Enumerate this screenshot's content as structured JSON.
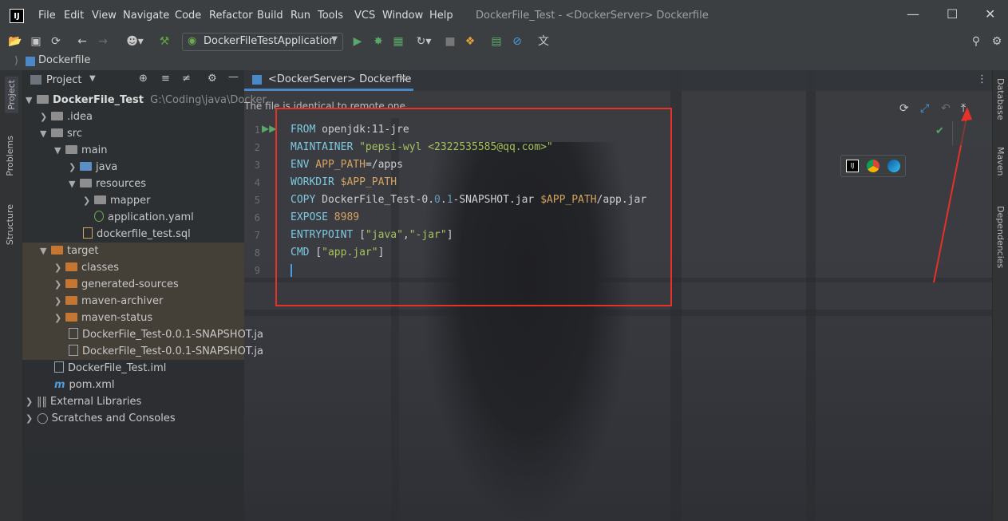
{
  "app": {
    "window_title": "DockerFile_Test - <DockerServer> Dockerfile",
    "logo_text": "IJ"
  },
  "menu": [
    "File",
    "Edit",
    "View",
    "Navigate",
    "Code",
    "Refactor",
    "Build",
    "Run",
    "Tools",
    "VCS",
    "Window",
    "Help"
  ],
  "toolbar": {
    "run_config": "DockerFileTestApplication"
  },
  "breadcrumb": {
    "item": "Dockerfile"
  },
  "left_stripe": {
    "tabs": [
      "Project",
      "Problems",
      "Structure"
    ]
  },
  "project": {
    "title": "Project",
    "root_name": "DockerFile_Test",
    "root_path": "G:\\Coding\\java\\Docker",
    "items": [
      ".idea",
      "src",
      "main",
      "java",
      "resources",
      "mapper",
      "application.yaml",
      "dockerfile_test.sql",
      "target",
      "classes",
      "generated-sources",
      "maven-archiver",
      "maven-status",
      "DockerFile_Test-0.0.1-SNAPSHOT.ja",
      "DockerFile_Test-0.0.1-SNAPSHOT.ja",
      "DockerFile_Test.iml",
      "pom.xml",
      "External Libraries",
      "Scratches and Consoles"
    ]
  },
  "editor": {
    "tab_label": "<DockerServer> Dockerfile",
    "notice": "The file is identical to remote one.",
    "line_numbers": [
      "1",
      "2",
      "3",
      "4",
      "5",
      "6",
      "7",
      "8",
      "9"
    ],
    "code": {
      "l1": {
        "kw": "FROM",
        "rest": " openjdk:11-jre"
      },
      "l2": {
        "kw": "MAINTAINER",
        "rest": " \"pepsi-wyl <2322535585@qq.com>\""
      },
      "l3": {
        "kw": "ENV",
        "a": " APP_PATH",
        "b": "=/apps"
      },
      "l4": {
        "kw": "WORKDIR",
        "a": " $APP_PATH"
      },
      "l5": {
        "kw": "COPY",
        "a": " DockerFile_Test-0.",
        "b": "0",
        "c": ".",
        "d": "1",
        "e": "-SNAPSHOT.jar ",
        "f": "$APP_PATH",
        "g": "/app.jar"
      },
      "l6": {
        "kw": "EXPOSE",
        "a": " 8989"
      },
      "l7": {
        "kw": "ENTRYPOINT",
        "a": " [",
        "b": "\"java\"",
        "c": ",",
        "d": "\"-jar\"",
        "e": "]"
      },
      "l8": {
        "kw": "CMD",
        "a": " [",
        "b": "\"app.jar\"",
        "c": "]"
      }
    }
  },
  "right_stripe": {
    "tabs": [
      "Database",
      "Maven",
      "Dependencies"
    ]
  },
  "colors": {
    "accent": "#4a88c7",
    "annotation": "#e6312a"
  }
}
